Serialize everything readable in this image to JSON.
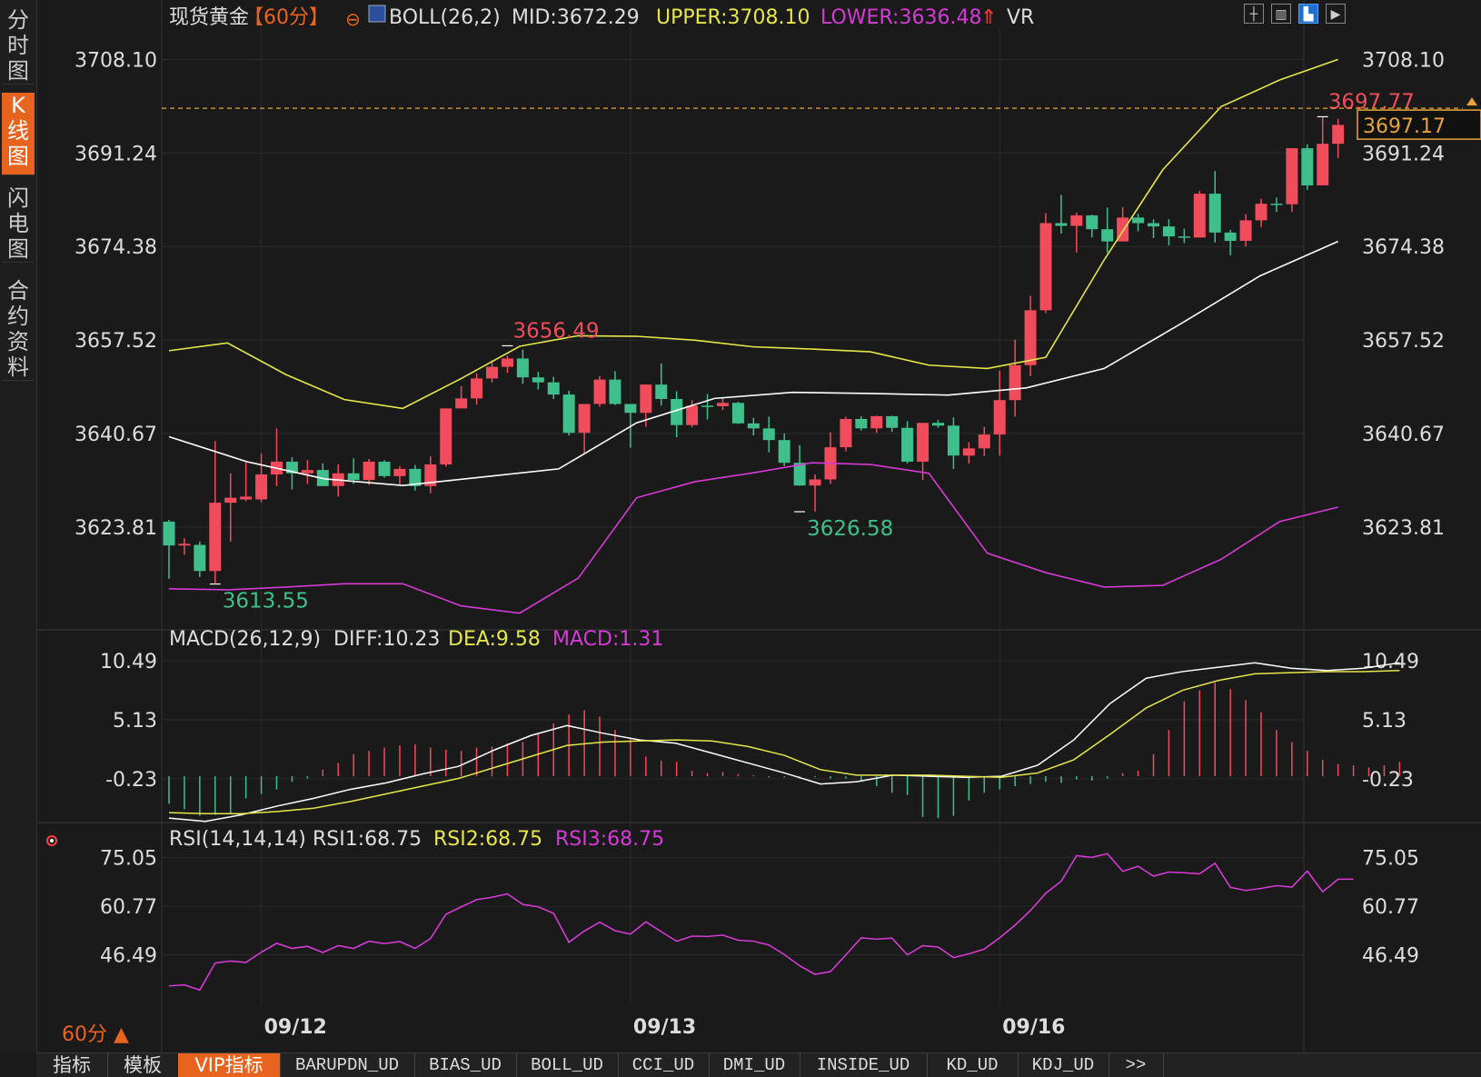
{
  "colors": {
    "up": "#f04c5c",
    "down": "#3fbf8c",
    "mid": "#ffffff",
    "upper": "#e6e64a",
    "lower": "#d63ad6",
    "diff": "#ffffff",
    "dea": "#e6e64a",
    "rsi": "#d63ad6",
    "grid": "#2c2c2c",
    "axisText": "#dddddd",
    "lastPrice": "#e8a33a",
    "label_red": "#f04c5c",
    "label_green": "#3fbf8c",
    "bg": "#1a1a1a"
  },
  "sidebar": {
    "items": [
      {
        "label": "分时图",
        "active": false
      },
      {
        "label": "K线图",
        "active": true
      },
      {
        "label": "闪电图",
        "active": false
      },
      {
        "label": "合约资料",
        "active": false
      }
    ]
  },
  "toolbar": {
    "icons": [
      "crosshair-icon",
      "chart-layout-icon",
      "chart-type-icon",
      "next-icon"
    ]
  },
  "header": {
    "symbol": "现货黄金",
    "period": "【60分】",
    "boll_title": "BOLL(26,2)",
    "mid": "MID:3672.29",
    "upper": "UPPER:3708.10",
    "lower": "LOWER:3636.48",
    "vr": "VR"
  },
  "macd_header": {
    "title": "MACD(26,12,9)",
    "diff": "DIFF:10.23",
    "dea": "DEA:9.58",
    "macd": "MACD:1.31"
  },
  "rsi_header": {
    "title": "RSI(14,14,14)",
    "rsi1": "RSI1:68.75",
    "rsi2": "RSI2:68.75",
    "rsi3": "RSI3:68.75"
  },
  "period_label": "60分 ▲",
  "bottom_tabs": [
    "指标",
    "模板",
    "VIP指标",
    "BARUPDN_UD",
    "BIAS_UD",
    "BOLL_UD",
    "CCI_UD",
    "DMI_UD",
    "INSIDE_UD",
    "KD_UD",
    "KDJ_UD",
    ">>"
  ],
  "bottom_active": "VIP指标",
  "chart_data": [
    {
      "type": "candlestick",
      "name": "现货黄金 60分",
      "ylim": [
        3606.6,
        3713.9
      ],
      "yticks": [
        "3708.10",
        "3691.24",
        "3674.38",
        "3657.52",
        "3640.67",
        "3623.81"
      ],
      "x_labels": [
        {
          "index": 6,
          "label": "09/12"
        },
        {
          "index": 30,
          "label": "09/13"
        },
        {
          "index": 54,
          "label": "09/16"
        }
      ],
      "candles": [
        [
          3624.8,
          3625.1,
          3614.5,
          3620.5
        ],
        [
          3620.5,
          3621.8,
          3618.8,
          3620.8
        ],
        [
          3620.6,
          3621.2,
          3614.8,
          3615.9
        ],
        [
          3615.9,
          3639.3,
          3613.6,
          3628.2
        ],
        [
          3628.2,
          3633.5,
          3621.2,
          3629.1
        ],
        [
          3628.8,
          3635.5,
          3628.5,
          3629.3
        ],
        [
          3628.8,
          3637.1,
          3628.3,
          3633.3
        ],
        [
          3633.3,
          3641.6,
          3631.2,
          3635.6
        ],
        [
          3635.6,
          3636.4,
          3630.6,
          3633.5
        ],
        [
          3633.5,
          3635.9,
          3631.6,
          3634.1
        ],
        [
          3634.1,
          3635.3,
          3631.2,
          3631.2
        ],
        [
          3631.2,
          3635.1,
          3629.3,
          3633.5
        ],
        [
          3633.5,
          3636.2,
          3631.6,
          3632.3
        ],
        [
          3632.3,
          3636.1,
          3631.4,
          3635.6
        ],
        [
          3635.6,
          3635.9,
          3632.7,
          3633.0
        ],
        [
          3633.0,
          3634.8,
          3631.5,
          3634.3
        ],
        [
          3634.3,
          3635.0,
          3630.4,
          3631.2
        ],
        [
          3631.2,
          3636.6,
          3629.9,
          3635.1
        ],
        [
          3635.1,
          3645.2,
          3634.7,
          3645.2
        ],
        [
          3645.2,
          3649.2,
          3645.2,
          3647.0
        ],
        [
          3647.0,
          3651.5,
          3645.9,
          3650.6
        ],
        [
          3650.6,
          3653.9,
          3649.9,
          3652.7
        ],
        [
          3652.7,
          3654.7,
          3651.6,
          3654.2
        ],
        [
          3654.2,
          3655.8,
          3649.6,
          3650.8
        ],
        [
          3650.8,
          3651.8,
          3648.6,
          3649.9
        ],
        [
          3649.9,
          3650.9,
          3646.9,
          3647.7
        ],
        [
          3647.7,
          3648.4,
          3640.3,
          3640.8
        ],
        [
          3640.8,
          3645.9,
          3637.0,
          3646.0
        ],
        [
          3646.0,
          3651.0,
          3645.5,
          3650.4
        ],
        [
          3650.4,
          3651.9,
          3645.8,
          3646.0
        ],
        [
          3646.0,
          3646.0,
          3638.1,
          3644.4
        ],
        [
          3644.4,
          3649.5,
          3641.9,
          3649.5
        ],
        [
          3649.5,
          3653.3,
          3645.7,
          3646.9
        ],
        [
          3646.9,
          3648.3,
          3640.0,
          3642.2
        ],
        [
          3642.2,
          3646.7,
          3641.8,
          3645.7
        ],
        [
          3645.7,
          3647.8,
          3643.2,
          3645.6
        ],
        [
          3645.6,
          3647.2,
          3644.9,
          3646.2
        ],
        [
          3646.2,
          3646.4,
          3642.4,
          3642.5
        ],
        [
          3642.5,
          3643.5,
          3640.3,
          3641.6
        ],
        [
          3641.6,
          3643.7,
          3637.3,
          3639.5
        ],
        [
          3639.5,
          3640.7,
          3634.8,
          3635.4
        ],
        [
          3635.4,
          3638.6,
          3631.3,
          3631.3
        ],
        [
          3631.3,
          3633.3,
          3626.6,
          3632.4
        ],
        [
          3632.4,
          3640.9,
          3631.6,
          3638.2
        ],
        [
          3638.2,
          3643.7,
          3637.5,
          3643.3
        ],
        [
          3643.3,
          3643.8,
          3641.2,
          3641.6
        ],
        [
          3641.6,
          3643.9,
          3640.8,
          3643.8
        ],
        [
          3643.8,
          3643.9,
          3641.0,
          3641.7
        ],
        [
          3641.7,
          3642.9,
          3635.3,
          3635.6
        ],
        [
          3635.6,
          3642.2,
          3632.3,
          3642.6
        ],
        [
          3642.6,
          3643.1,
          3641.7,
          3642.1
        ],
        [
          3642.1,
          3643.6,
          3634.3,
          3636.7
        ],
        [
          3636.7,
          3639.1,
          3635.3,
          3638.0
        ],
        [
          3638.0,
          3641.9,
          3636.6,
          3640.5
        ],
        [
          3640.5,
          3652.0,
          3636.7,
          3646.7
        ],
        [
          3646.7,
          3657.6,
          3643.7,
          3653.0
        ],
        [
          3653.0,
          3665.5,
          3651.0,
          3662.9
        ],
        [
          3662.9,
          3680.4,
          3662.4,
          3678.6
        ],
        [
          3678.6,
          3683.7,
          3676.7,
          3678.1
        ],
        [
          3678.1,
          3680.5,
          3673.3,
          3680.0
        ],
        [
          3680.0,
          3680.1,
          3676.0,
          3677.5
        ],
        [
          3677.5,
          3681.4,
          3673.3,
          3675.3
        ],
        [
          3675.3,
          3681.5,
          3675.3,
          3679.6
        ],
        [
          3679.6,
          3680.3,
          3677.1,
          3678.6
        ],
        [
          3678.6,
          3679.3,
          3675.9,
          3678.0
        ],
        [
          3678.0,
          3679.3,
          3674.6,
          3676.2
        ],
        [
          3676.2,
          3677.6,
          3675.0,
          3676.0
        ],
        [
          3676.0,
          3684.4,
          3676.0,
          3683.9
        ],
        [
          3683.9,
          3688.0,
          3675.1,
          3676.9
        ],
        [
          3676.9,
          3677.4,
          3672.8,
          3675.4
        ],
        [
          3675.4,
          3680.2,
          3674.4,
          3679.1
        ],
        [
          3679.1,
          3683.0,
          3677.9,
          3682.1
        ],
        [
          3682.1,
          3683.2,
          3680.6,
          3682.0
        ],
        [
          3682.0,
          3692.1,
          3680.6,
          3692.1
        ],
        [
          3692.1,
          3692.8,
          3684.6,
          3685.4
        ],
        [
          3685.4,
          3697.8,
          3685.4,
          3692.9
        ],
        [
          3692.9,
          3697.4,
          3690.3,
          3696.3
        ]
      ],
      "boll_mid": [
        3640.1,
        3635.6,
        3632.5,
        3631.3,
        3632.8,
        3634.3,
        3642.6,
        3647.0,
        3648.1,
        3647.9,
        3647.6,
        3648.9,
        3652.4,
        3660.6,
        3669.1,
        3675.3
      ],
      "boll_upper": [
        3655.6,
        3657.0,
        3651.3,
        3646.8,
        3645.2,
        3650.6,
        3656.4,
        3658.3,
        3658.2,
        3657.5,
        3656.3,
        3655.9,
        3655.4,
        3653.0,
        3652.4,
        3654.4,
        3672.0,
        3688.2,
        3699.6,
        3704.4,
        3708.1
      ],
      "boll_lower": [
        3612.7,
        3612.5,
        3613.0,
        3613.6,
        3613.6,
        3609.6,
        3608.3,
        3614.6,
        3629.1,
        3632.0,
        3633.6,
        3635.4,
        3635.1,
        3633.5,
        3619.1,
        3615.6,
        3613.0,
        3613.3,
        3618.0,
        3624.8,
        3627.4
      ],
      "last_price": "3697.17",
      "annotations": [
        {
          "index": 3,
          "value": 3613.55,
          "label": "3613.55",
          "color": "green",
          "side": "below"
        },
        {
          "index": 22,
          "value": 3656.49,
          "label": "3656.49",
          "color": "red",
          "side": "above"
        },
        {
          "index": 41,
          "value": 3626.58,
          "label": "3626.58",
          "color": "green",
          "side": "below"
        },
        {
          "index": 75,
          "value": 3697.77,
          "label": "3697.77",
          "color": "red",
          "side": "above"
        }
      ]
    },
    {
      "type": "bar+line",
      "name": "MACD(26,12,9)",
      "ylim": [
        -4.2,
        12.3
      ],
      "yticks": [
        "10.49",
        "5.13",
        "-0.23"
      ],
      "diff": [
        -3.8,
        -4.1,
        -3.5,
        -2.7,
        -2.0,
        -1.2,
        -0.6,
        0.2,
        0.9,
        2.4,
        3.7,
        4.6,
        3.9,
        3.3,
        3.0,
        2.1,
        1.2,
        0.3,
        -0.7,
        -0.5,
        0.1,
        0.0,
        -0.1,
        0.0,
        1.0,
        3.3,
        6.6,
        8.9,
        9.5,
        9.9,
        10.3,
        9.8,
        9.6,
        9.8,
        10.3
      ],
      "dea": [
        -3.3,
        -3.4,
        -3.4,
        -3.2,
        -2.9,
        -2.3,
        -1.6,
        -0.9,
        -0.2,
        0.8,
        1.8,
        2.8,
        3.1,
        3.2,
        3.3,
        3.2,
        2.7,
        1.9,
        0.6,
        0.1,
        0.1,
        0.1,
        0.0,
        -0.1,
        0.3,
        1.5,
        3.8,
        6.2,
        7.8,
        8.7,
        9.3,
        9.4,
        9.5,
        9.5,
        9.6
      ],
      "macd": [
        -2.5,
        -3.0,
        -3.6,
        -3.5,
        -3.4,
        -2.0,
        -1.6,
        -1.2,
        -0.5,
        -0.2,
        0.6,
        1.2,
        2.0,
        2.3,
        2.6,
        2.8,
        2.9,
        2.6,
        2.4,
        2.3,
        2.6,
        2.7,
        3.0,
        3.1,
        3.8,
        4.8,
        5.6,
        6.0,
        5.4,
        4.2,
        3.4,
        1.8,
        1.4,
        1.3,
        0.5,
        0.3,
        0.4,
        0.2,
        0.1,
        -0.1,
        -0.1,
        -0.2,
        -0.1,
        -0.2,
        -0.2,
        -0.5,
        -0.9,
        -1.5,
        -1.7,
        -3.7,
        -3.8,
        -3.6,
        -2.2,
        -1.5,
        -1.2,
        -0.9,
        -0.7,
        -0.5,
        -0.6,
        -0.3,
        -0.4,
        -0.2,
        0.3,
        0.5,
        2.0,
        4.2,
        6.8,
        7.8,
        8.5,
        7.9,
        6.9,
        5.8,
        4.2,
        3.1,
        2.3,
        1.5,
        1.1,
        1.0,
        0.8,
        1.0,
        1.3
      ]
    },
    {
      "type": "line",
      "name": "RSI(14,14,14)",
      "ylim": [
        32.0,
        80.0
      ],
      "yticks": [
        "75.05",
        "60.77",
        "46.49"
      ],
      "values": [
        37.4,
        37.7,
        36.2,
        44.1,
        44.7,
        44.3,
        47.3,
        49.9,
        48.4,
        49.0,
        47.2,
        49.2,
        48.4,
        50.5,
        49.8,
        50.4,
        48.4,
        51.3,
        58.4,
        60.6,
        62.7,
        63.4,
        64.4,
        61.3,
        60.6,
        58.7,
        50.2,
        53.5,
        56.1,
        53.6,
        52.6,
        56.2,
        53.3,
        50.5,
        52.0,
        51.9,
        52.3,
        50.8,
        50.5,
        49.4,
        46.6,
        43.3,
        40.8,
        41.6,
        46.5,
        51.5,
        51.1,
        51.4,
        46.5,
        49.2,
        48.8,
        45.7,
        46.8,
        48.2,
        51.5,
        55.2,
        59.5,
        64.6,
        68.1,
        75.6,
        75.1,
        76.2,
        71.0,
        72.5,
        69.6,
        70.8,
        70.6,
        70.3,
        73.4,
        66.3,
        65.4,
        66.0,
        66.8,
        66.4,
        71.1,
        65.0,
        68.7,
        68.7
      ]
    }
  ]
}
